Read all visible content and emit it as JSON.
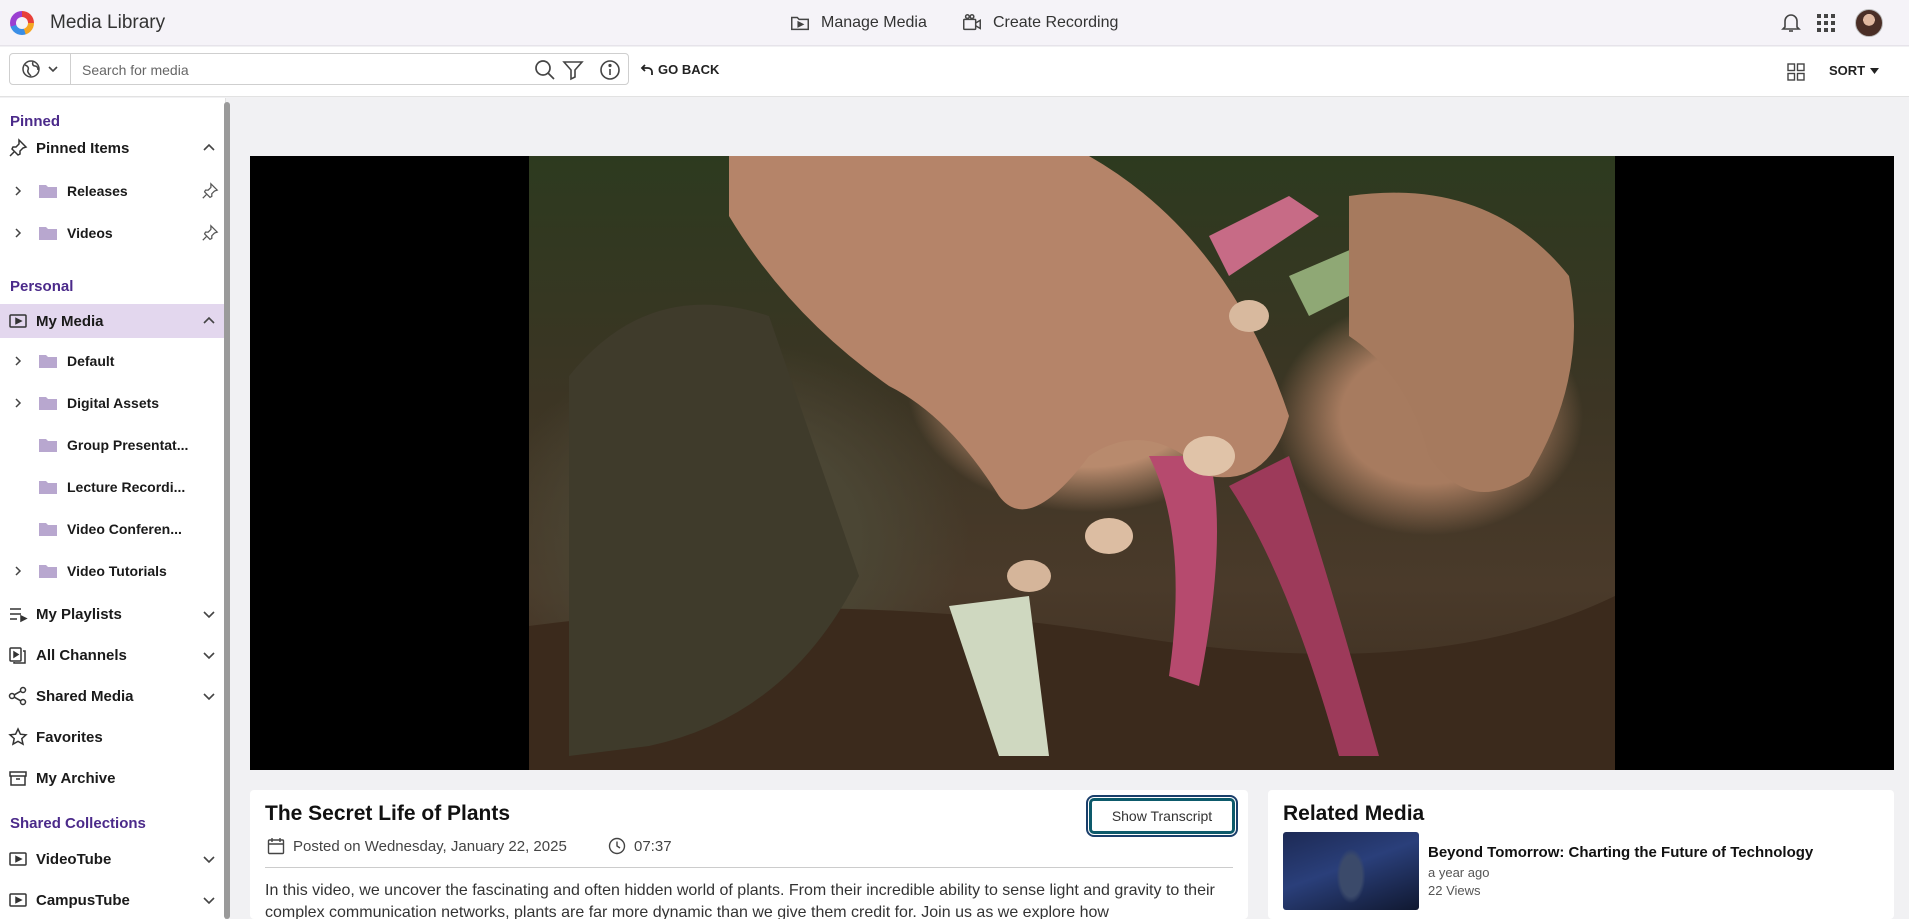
{
  "app": {
    "title": "Media Library"
  },
  "header": {
    "manage_media": "Manage Media",
    "create_recording": "Create Recording"
  },
  "search": {
    "placeholder": "Search for media",
    "go_back": "GO BACK",
    "sort": "SORT"
  },
  "sidebar": {
    "pinned_title": "Pinned",
    "pinned_items": {
      "label": "Pinned Items",
      "children": [
        "Releases",
        "Videos"
      ]
    },
    "personal_title": "Personal",
    "my_media": {
      "label": "My Media",
      "children": [
        "Default",
        "Digital Assets",
        "Group Presentat...",
        "Lecture Recordi...",
        "Video Conferen...",
        "Video Tutorials"
      ]
    },
    "my_playlists": "My Playlists",
    "all_channels": "All Channels",
    "shared_media": "Shared Media",
    "favorites": "Favorites",
    "my_archive": "My Archive",
    "shared_collections_title": "Shared Collections",
    "videotube": "VideoTube",
    "campustube": "CampusTube"
  },
  "media": {
    "title": "The Secret Life of Plants",
    "posted": "Posted on Wednesday, January 22, 2025",
    "duration": "07:37",
    "show_transcript": "Show Transcript",
    "description": "In this video, we uncover the fascinating and often hidden world of plants. From their incredible ability to sense light and gravity to their complex communication networks, plants are far more dynamic than we give them credit for. Join us as we explore how"
  },
  "related": {
    "title": "Related Media",
    "items": [
      {
        "title": "Beyond Tomorrow: Charting the Future of Technology",
        "age": "a year ago",
        "views": "22 Views"
      }
    ]
  },
  "colors": {
    "accent": "#4b2a8a",
    "active_bg": "#e3d7ee",
    "focus_ring": "#0d5a6b"
  }
}
